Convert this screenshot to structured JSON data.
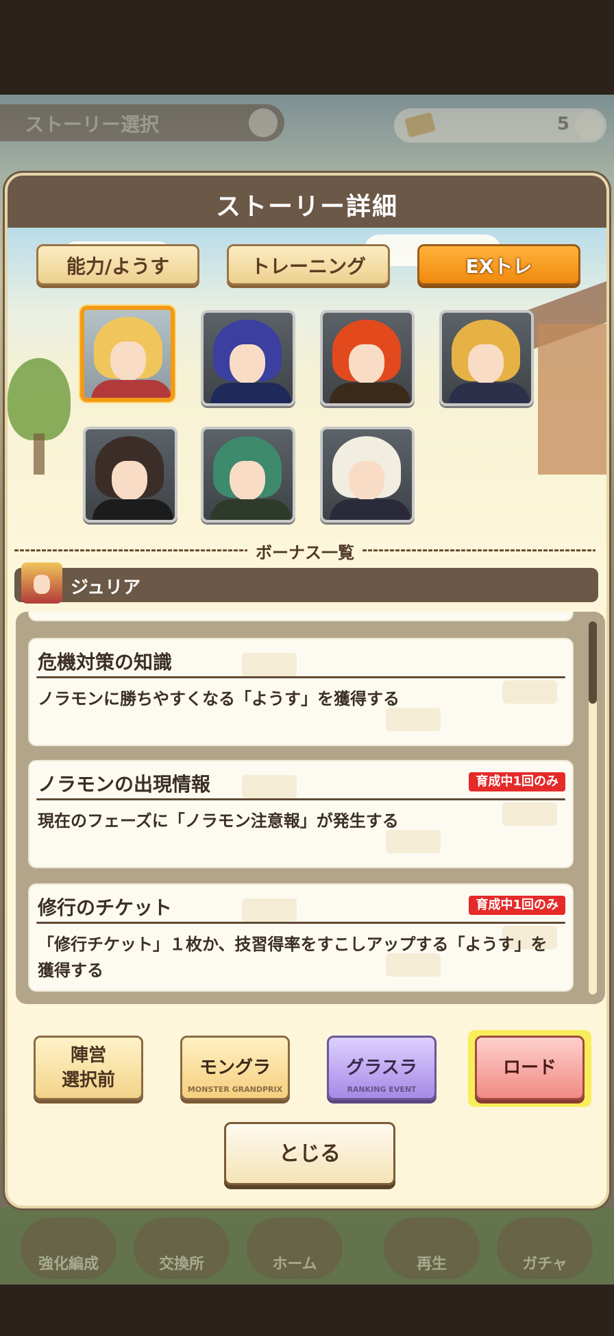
{
  "background": {
    "story_select_label": "ストーリー選択",
    "ticket_count": "5",
    "nav": [
      "強化編成",
      "交換所",
      "ホーム",
      "再生",
      "ガチャ"
    ]
  },
  "dialog": {
    "title": "ストーリー詳細",
    "tabs": [
      {
        "label": "能力/ようす",
        "active": false
      },
      {
        "label": "トレーニング",
        "active": false
      },
      {
        "label": "EXトレ",
        "active": true
      }
    ],
    "selected_character": "ジュリア",
    "bonus_header": "ボーナス一覧",
    "bonuses": [
      {
        "title": "危機対策の知識",
        "description": "ノラモンに勝ちやすくなる「ようす」を獲得する",
        "badge": ""
      },
      {
        "title": "ノラモンの出現情報",
        "description": "現在のフェーズに「ノラモン注意報」が発生する",
        "badge": "育成中1回のみ"
      },
      {
        "title": "修行のチケット",
        "description": "「修行チケット」１枚か、技習得率をすこしアップする「ようす」を獲得する",
        "badge": "育成中1回のみ"
      }
    ],
    "buttons": {
      "camp_line1": "陣営",
      "camp_line2": "選択前",
      "mongura": "モングラ",
      "mongura_sub": "MONSTER GRANDPRIX",
      "gurasura": "グラスラ",
      "gurasura_sub": "RANKING EVENT",
      "road": "ロード",
      "close": "とじる"
    }
  },
  "colors": {
    "header_brown": "#6c5847",
    "active_tab_orange": "#f08a0f",
    "badge_red": "#e52a2a",
    "panel_cream": "#fdf6da"
  },
  "icons": [
    "info-icon",
    "ticket-icon"
  ]
}
